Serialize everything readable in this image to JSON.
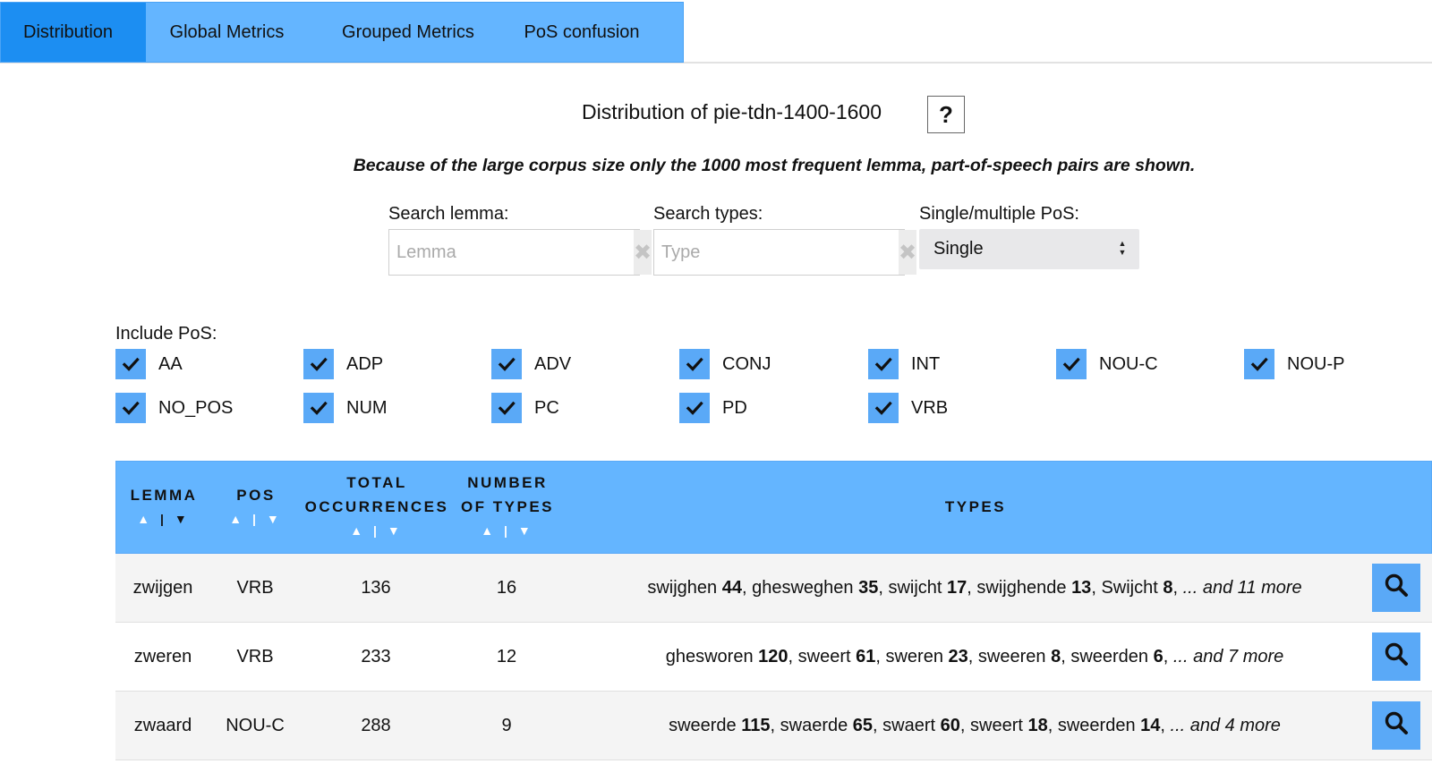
{
  "tabs": [
    {
      "label": "Distribution",
      "active": true
    },
    {
      "label": "Global Metrics",
      "active": false
    },
    {
      "label": "Grouped Metrics",
      "active": false
    },
    {
      "label": "PoS confusion",
      "active": false
    }
  ],
  "title": "Distribution of pie-tdn-1400-1600",
  "help_label": "?",
  "notice": "Because of the large corpus size only the 1000 most frequent lemma, part-of-speech pairs are shown.",
  "search": {
    "lemma_label": "Search lemma:",
    "lemma_placeholder": "Lemma",
    "types_label": "Search types:",
    "types_placeholder": "Type",
    "pos_mode_label": "Single/multiple PoS:",
    "pos_mode_value": "Single",
    "clear_icon": "✖"
  },
  "include_pos": {
    "label": "Include PoS:",
    "items": [
      {
        "label": "AA",
        "checked": true
      },
      {
        "label": "ADP",
        "checked": true
      },
      {
        "label": "ADV",
        "checked": true
      },
      {
        "label": "CONJ",
        "checked": true
      },
      {
        "label": "INT",
        "checked": true
      },
      {
        "label": "NOU-C",
        "checked": true
      },
      {
        "label": "NOU-P",
        "checked": true
      },
      {
        "label": "NO_POS",
        "checked": true
      },
      {
        "label": "NUM",
        "checked": true
      },
      {
        "label": "PC",
        "checked": true
      },
      {
        "label": "PD",
        "checked": true
      },
      {
        "label": "VRB",
        "checked": true
      }
    ]
  },
  "table": {
    "headers": {
      "lemma": [
        "LEMMA"
      ],
      "pos": [
        "POS"
      ],
      "total": [
        "TOTAL",
        "OCCURRENCES"
      ],
      "num_types": [
        "NUMBER",
        "OF TYPES"
      ],
      "types": [
        "TYPES"
      ]
    },
    "sort_up": "▲",
    "sort_down": "▼",
    "sort_sep": "|",
    "rows": [
      {
        "lemma": "zwijgen",
        "pos": "VRB",
        "total": "136",
        "num_types": "16",
        "types": [
          [
            "swijghen",
            "44"
          ],
          [
            "ghesweghen",
            "35"
          ],
          [
            "swijcht",
            "17"
          ],
          [
            "swijghende",
            "13"
          ],
          [
            "Swijcht",
            "8"
          ]
        ],
        "more": "... and 11 more"
      },
      {
        "lemma": "zweren",
        "pos": "VRB",
        "total": "233",
        "num_types": "12",
        "types": [
          [
            "ghesworen",
            "120"
          ],
          [
            "sweert",
            "61"
          ],
          [
            "sweren",
            "23"
          ],
          [
            "sweeren",
            "8"
          ],
          [
            "sweerden",
            "6"
          ]
        ],
        "more": "... and 7 more"
      },
      {
        "lemma": "zwaard",
        "pos": "NOU-C",
        "total": "288",
        "num_types": "9",
        "types": [
          [
            "sweerde",
            "115"
          ],
          [
            "swaerde",
            "65"
          ],
          [
            "swaert",
            "60"
          ],
          [
            "sweert",
            "18"
          ],
          [
            "sweerden",
            "14"
          ]
        ],
        "more": "... and 4 more"
      }
    ]
  },
  "colors": {
    "tab_bg": "#64b5ff",
    "tab_active": "#1c8ef2",
    "checkbox": "#5aa9f7",
    "header_bg": "#64b5ff"
  }
}
